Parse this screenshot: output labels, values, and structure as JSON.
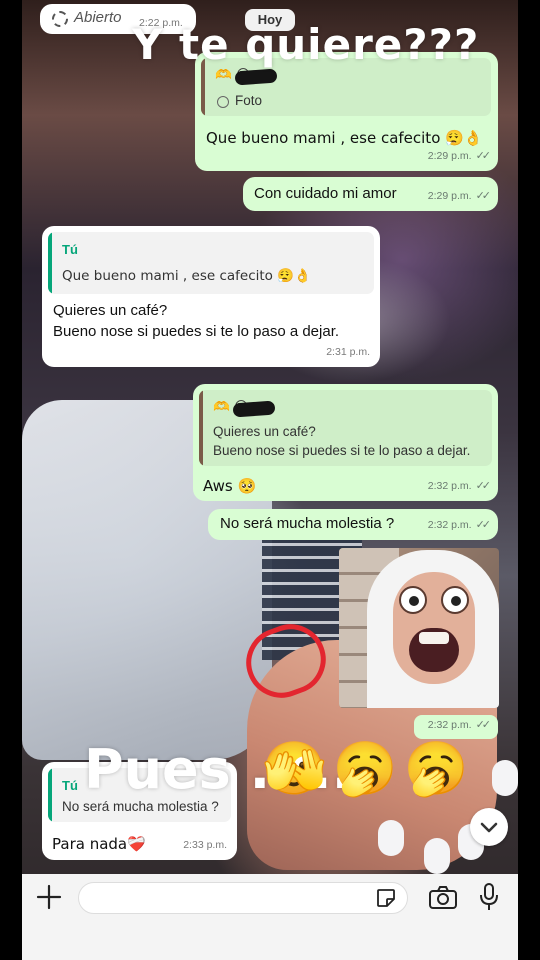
{
  "status_chip": {
    "label": "Abierto",
    "time": "2:22 p.m."
  },
  "date_chip": "Hoy",
  "overlay": {
    "title": "Y te quiere???",
    "caption": "Pues .....",
    "caption_emojis": "🫣🥱🥱"
  },
  "messages": [
    {
      "id": "m1",
      "direction": "out",
      "reply_emoji": "🫶 😍",
      "reply_label": "Foto",
      "text": "Que bueno mami , ese cafecito 😮‍💨👌",
      "time": "2:29 p.m.",
      "ticks": "✓✓"
    },
    {
      "id": "m2",
      "direction": "out",
      "text": "Con cuidado mi amor",
      "time": "2:29 p.m.",
      "ticks": "✓✓"
    },
    {
      "id": "m3",
      "direction": "in",
      "reply_name": "Tú",
      "reply_text": "Que bueno mami , ese cafecito 😮‍💨👌",
      "text_line1": "Quieres un café?",
      "text_line2": "Bueno nose si puedes si te lo paso a dejar.",
      "time": "2:31 p.m."
    },
    {
      "id": "m4",
      "direction": "out",
      "reply_emoji": "🫶 😍",
      "reply_line1": "Quieres un café?",
      "reply_line2": "Bueno nose si puedes si te lo paso a dejar.",
      "text": "Aws 🥺",
      "time": "2:32 p.m.",
      "ticks": "✓✓"
    },
    {
      "id": "m5",
      "direction": "out",
      "text": "No será mucha molestia ?",
      "time": "2:32 p.m.",
      "ticks": "✓✓"
    },
    {
      "id": "m6",
      "direction": "out",
      "type": "image",
      "time": "2:32 p.m.",
      "ticks": "✓✓"
    },
    {
      "id": "m7",
      "direction": "in",
      "reply_name": "Tú",
      "reply_text": "No será mucha molestia ?",
      "text": "Para nada❤️‍🩹",
      "time": "2:33 p.m."
    }
  ],
  "input_bar": {
    "placeholder": "",
    "icons": [
      "plus-icon",
      "sticker-icon",
      "camera-icon",
      "microphone-icon"
    ]
  },
  "colors": {
    "outgoing_bubble": "#d9fdd3",
    "incoming_bubble": "#ffffff",
    "quote_accent": "#06a67a",
    "overlay_text": "#ffffff"
  }
}
